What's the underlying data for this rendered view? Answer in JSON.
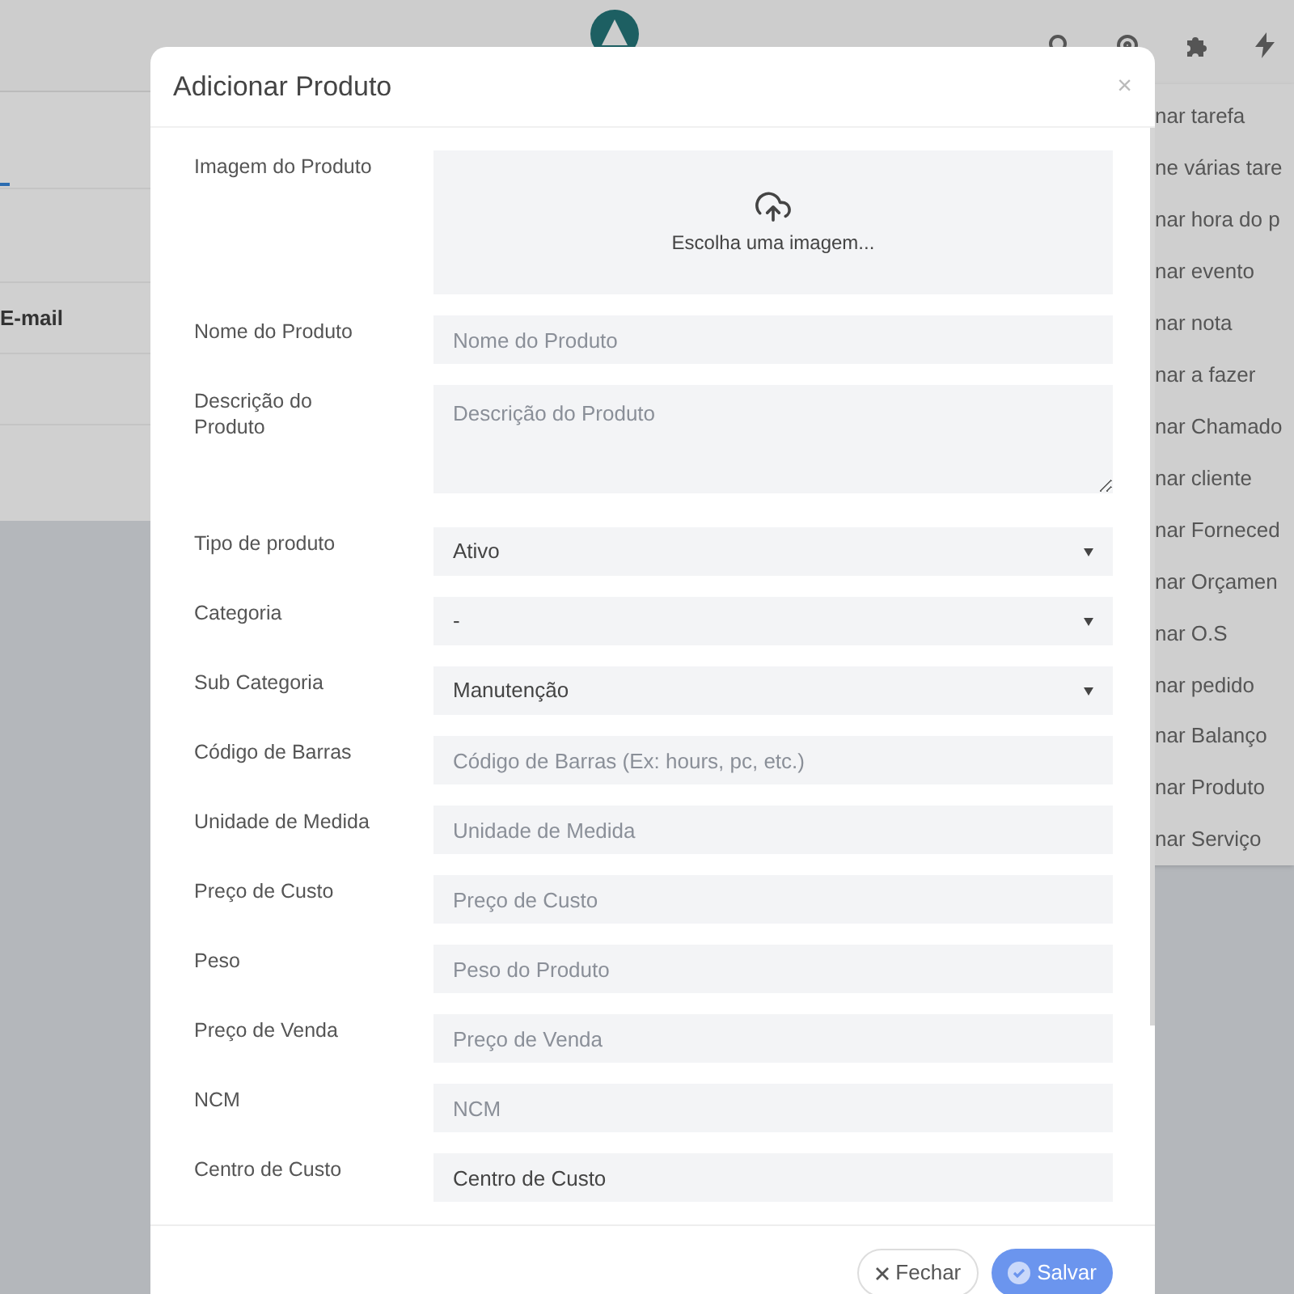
{
  "side_panel": {
    "items": [
      {
        "kind": "tab"
      },
      {
        "label": "E-mail",
        "kind": "text"
      }
    ]
  },
  "quick_menu": {
    "items": [
      "nar tarefa",
      "ne várias tare",
      "nar hora do p",
      "nar evento",
      "nar nota",
      "nar a fazer",
      "nar Chamado",
      "nar cliente",
      "nar Forneced",
      "nar Orçamen",
      "nar O.S",
      "nar pedido",
      "nar Balanço",
      "nar Produto",
      "nar Serviço"
    ]
  },
  "modal": {
    "title": "Adicionar Produto",
    "close": "×",
    "fields": [
      {
        "label": "Imagem do Produto",
        "kind": "upload",
        "placeholder": "Escolha uma imagem..."
      },
      {
        "label": "Nome do Produto",
        "kind": "input",
        "placeholder": "Nome do Produto"
      },
      {
        "label": "Descrição do Produto",
        "kind": "textarea",
        "placeholder": "Descrição do Produto"
      },
      {
        "label": "Tipo de produto",
        "kind": "select",
        "value": "Ativo"
      },
      {
        "label": "Categoria",
        "kind": "select",
        "value": "-"
      },
      {
        "label": "Sub Categoria",
        "kind": "select",
        "value": "Manutenção"
      },
      {
        "label": "Código de Barras",
        "kind": "input",
        "placeholder": "Código de Barras (Ex: hours, pc, etc.)"
      },
      {
        "label": "Unidade de Medida",
        "kind": "input",
        "placeholder": "Unidade de Medida"
      },
      {
        "label": "Preço de Custo",
        "kind": "input",
        "placeholder": "Preço de Custo"
      },
      {
        "label": "Peso",
        "kind": "input",
        "placeholder": "Peso do Produto"
      },
      {
        "label": "Preço de Venda",
        "kind": "input",
        "placeholder": "Preço de Venda"
      },
      {
        "label": "NCM",
        "kind": "input",
        "placeholder": "NCM"
      },
      {
        "label": "Centro de Custo",
        "kind": "input",
        "value": "Centro de Custo"
      }
    ],
    "buttons": [
      {
        "label": "Fechar",
        "kind": "secondary"
      },
      {
        "label": "Salvar",
        "kind": "primary"
      }
    ]
  }
}
